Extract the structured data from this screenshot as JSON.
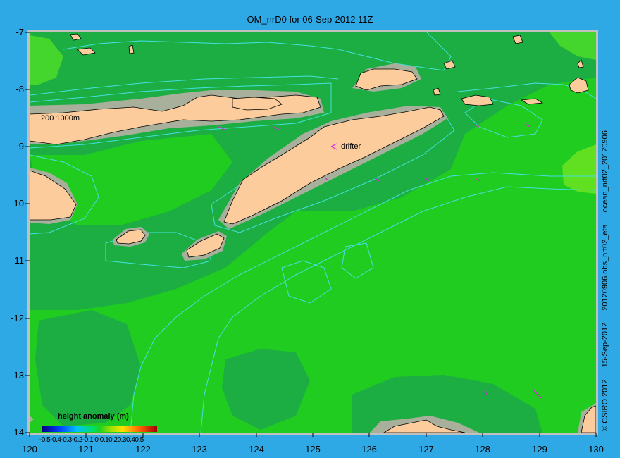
{
  "title": "OM_nrD0 for 06-Sep-2012 11Z",
  "y_ticks": [
    "-7",
    "-8",
    "-9",
    "-10",
    "-11",
    "-12",
    "-13",
    "-14"
  ],
  "x_ticks": [
    "120",
    "121",
    "122",
    "123",
    "124",
    "125",
    "126",
    "127",
    "128",
    "129",
    "130"
  ],
  "right_text": {
    "copyright": "CSIRO 2012",
    "date": "15-Sep-2012",
    "file": "ocean_nrt02_20120906",
    "obs": "20120906.obs_nrt02_eta"
  },
  "colorbar": {
    "label": "height anomaly  (m)",
    "ticks": "-0.5-0.4-0.3-0.2-0.1 0 0.10.20.30.40.5"
  },
  "annotations": {
    "drifter": "drifter",
    "isobaths": "200  1000m"
  },
  "colors": {
    "ocean": "#1fcc1f",
    "ocean_dark": "#1cae42",
    "land": "#fccc9c",
    "shelf": "#a8b09c",
    "contour": "#44e0e0",
    "frame": "#c0c0c0",
    "arrow": "#e020e0"
  }
}
